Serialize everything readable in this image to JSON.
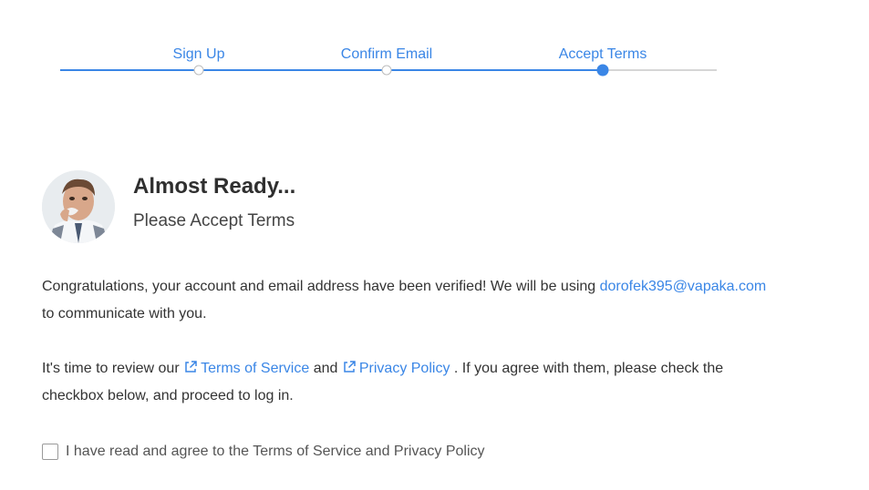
{
  "stepper": {
    "steps": [
      {
        "label": "Sign Up",
        "state": "complete"
      },
      {
        "label": "Confirm Email",
        "state": "complete"
      },
      {
        "label": "Accept Terms",
        "state": "current"
      }
    ],
    "colors": {
      "active": "#3a86e6",
      "inactive": "#d6d6d6"
    }
  },
  "header": {
    "avatar_icon": "user-photo",
    "title": "Almost Ready...",
    "subtitle": "Please Accept Terms"
  },
  "body": {
    "p1_text": "Congratulations, your account and email address have been verified! We will be using",
    "email": "dorofek395@vapaka.com",
    "p1_suffix": "to communicate with you.",
    "p2_prefix": "It's time to review our",
    "terms_link": "Terms of Service",
    "and": "and",
    "privacy_link": "Privacy Policy",
    "p2_suffix": ". If you agree with them, please check the checkbox below, and proceed to log in.",
    "link_icon": "external-link-icon"
  },
  "agreement": {
    "label": "I have read and agree to the Terms of Service and Privacy Policy",
    "checked": false
  }
}
